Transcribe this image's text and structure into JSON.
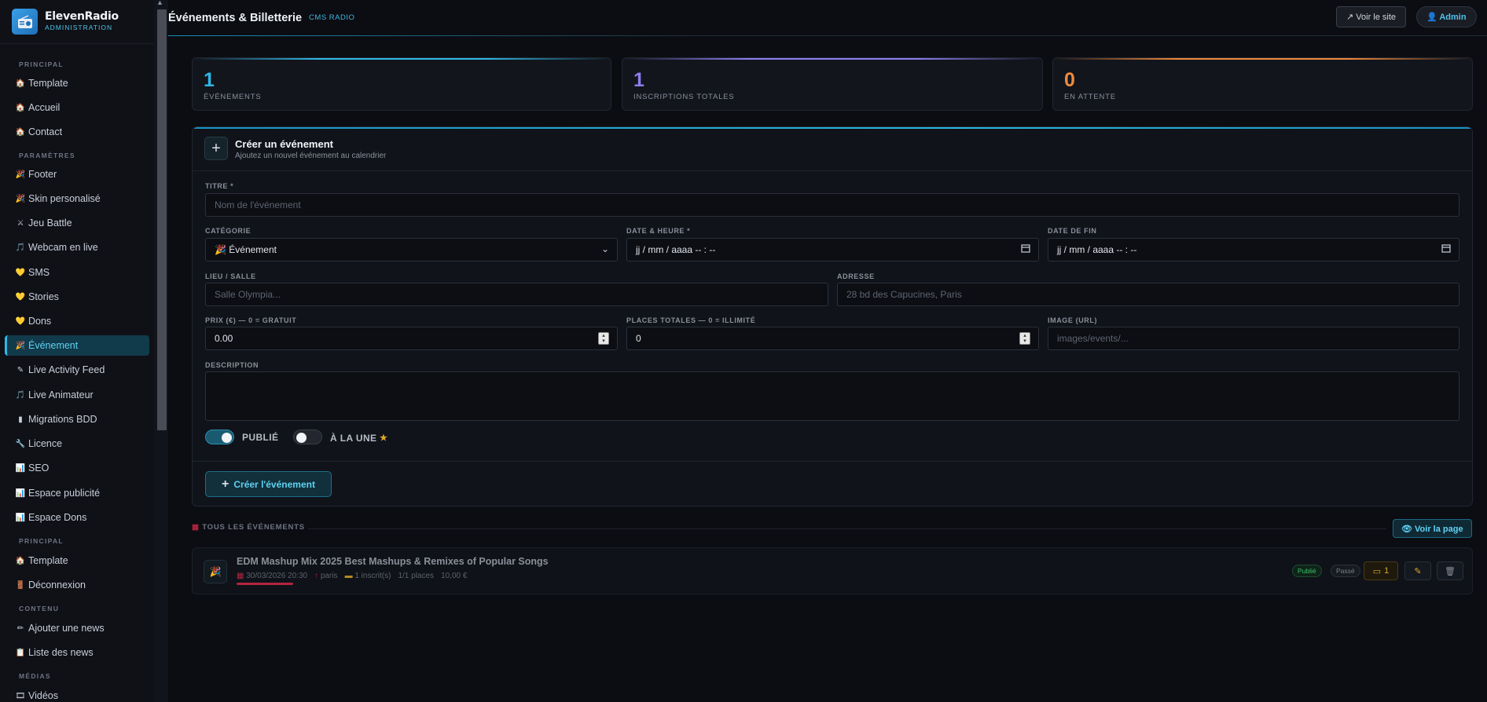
{
  "brand": {
    "name": "ElevenRadio",
    "sub": "ADMINISTRATION"
  },
  "sidebar": {
    "sections": [
      "PRINCIPAL",
      "PARAMÈTRES",
      "PRINCIPAL",
      "CONTENU",
      "MÉDIAS"
    ],
    "items": [
      {
        "icon": "🏠",
        "label": "Template"
      },
      {
        "icon": "🏠",
        "label": "Accueil"
      },
      {
        "icon": "🏠",
        "label": "Contact"
      },
      {
        "icon": "🎉",
        "label": "Footer"
      },
      {
        "icon": "🎉",
        "label": "Skin personalisé"
      },
      {
        "icon": "⚔",
        "label": "Jeu Battle"
      },
      {
        "icon": "🎵",
        "label": "Webcam en live"
      },
      {
        "icon": "💛",
        "label": "SMS"
      },
      {
        "icon": "💛",
        "label": "Stories"
      },
      {
        "icon": "💛",
        "label": "Dons"
      },
      {
        "icon": "🎉",
        "label": "Événement"
      },
      {
        "icon": "✎",
        "label": "Live Activity Feed"
      },
      {
        "icon": "🎵",
        "label": "Live Animateur"
      },
      {
        "icon": "▮",
        "label": "Migrations BDD"
      },
      {
        "icon": "🔧",
        "label": "Licence"
      },
      {
        "icon": "📊",
        "label": "SEO"
      },
      {
        "icon": "📊",
        "label": "Espace publicité"
      },
      {
        "icon": "📊",
        "label": "Espace Dons"
      },
      {
        "icon": "🏠",
        "label": "Template"
      },
      {
        "icon": "🚪",
        "label": "Déconnexion"
      },
      {
        "icon": "✏",
        "label": "Ajouter une news"
      },
      {
        "icon": "📋",
        "label": "Liste des news"
      },
      {
        "icon": "🎞",
        "label": "Vidéos"
      }
    ]
  },
  "header": {
    "title": "Événements & Billetterie",
    "tag": "CMS RADIO",
    "view_site": "↗ Voir le site",
    "admin": "👤 Admin"
  },
  "stats": [
    {
      "value": "1",
      "label": "ÉVÉNEMENTS",
      "color": "#2fb8e6"
    },
    {
      "value": "1",
      "label": "INSCRIPTIONS TOTALES",
      "color": "#8f7cf0"
    },
    {
      "value": "0",
      "label": "EN ATTENTE",
      "color": "#f08a3c"
    }
  ],
  "form": {
    "title": "Créer un événement",
    "subtitle": "Ajoutez un nouvel événement au calendrier",
    "titre_label": "TITRE *",
    "titre_placeholder": "Nom de l'événement",
    "categorie_label": "CATÉGORIE",
    "categorie_value": "🎉  Événement",
    "date_label": "DATE & HEURE *",
    "date_value": "jj / mm / aaaa   -- : --",
    "datefin_label": "DATE DE FIN",
    "datefin_value": "jj / mm / aaaa   -- : --",
    "lieu_label": "LIEU / SALLE",
    "lieu_placeholder": "Salle Olympia...",
    "adresse_label": "ADRESSE",
    "adresse_placeholder": "28 bd des Capucines, Paris",
    "prix_label": "PRIX (€) — 0 = GRATUIT",
    "prix_value": "0.00",
    "places_label": "PLACES TOTALES — 0 = ILLIMITÉ",
    "places_value": "0",
    "image_label": "IMAGE (URL)",
    "image_placeholder": "images/events/...",
    "description_label": "DESCRIPTION",
    "publie_label": "PUBLIÉ",
    "publie_on": true,
    "une_label": "À LA UNE",
    "une_on": false,
    "submit": "Créer l'événement"
  },
  "events": {
    "heading": "TOUS LES ÉVÉNEMENTS",
    "view_page": "👁 Voir la page",
    "rows": [
      {
        "title": "EDM Mashup Mix 2025 Best Mashups & Remixes of Popular Songs",
        "date": "30/03/2026 20:30",
        "city": "paris",
        "inscrits": "1 inscrit(s)",
        "places": "1/1 places",
        "price": "10,00 €",
        "badge_published": "Publié",
        "badge_past": "Passé",
        "count": "1"
      }
    ]
  }
}
